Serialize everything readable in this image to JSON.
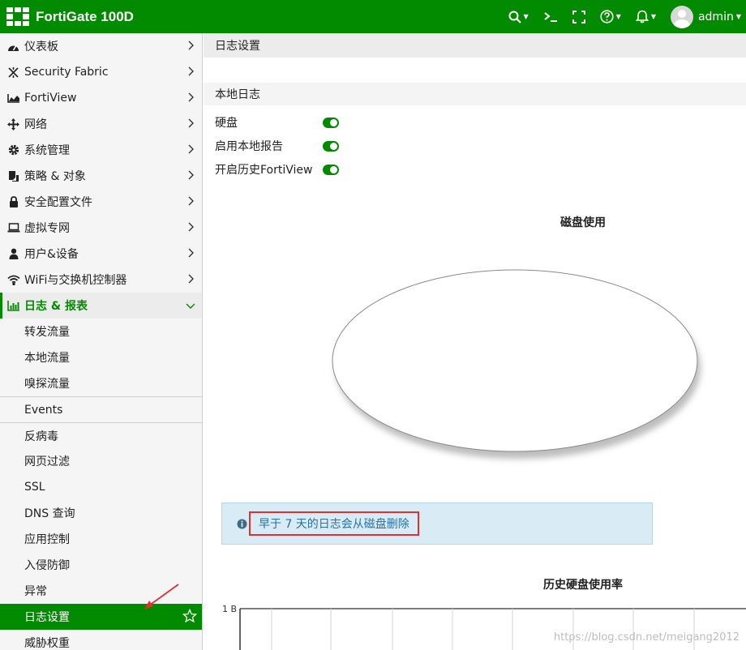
{
  "topbar": {
    "brand": "FortiGate 100D",
    "user": "admin",
    "color": "#028a00"
  },
  "sidebar": {
    "items": [
      {
        "label": "仪表板",
        "icon": "dashboard-icon"
      },
      {
        "label": "Security Fabric",
        "icon": "security-fabric-icon"
      },
      {
        "label": "FortiView",
        "icon": "fortiview-icon"
      },
      {
        "label": "网络",
        "icon": "network-icon"
      },
      {
        "label": "系统管理",
        "icon": "gear-icon"
      },
      {
        "label": "策略 & 对象",
        "icon": "policy-icon"
      },
      {
        "label": "安全配置文件",
        "icon": "lock-icon"
      },
      {
        "label": "虚拟专网",
        "icon": "laptop-icon"
      },
      {
        "label": "用户&设备",
        "icon": "user-icon"
      },
      {
        "label": "WiFi与交换机控制器",
        "icon": "wifi-icon"
      },
      {
        "label": "日志 & 报表",
        "icon": "log-report-icon"
      }
    ],
    "subitems": [
      "转发流量",
      "本地流量",
      "嗅探流量",
      "Events",
      "反病毒",
      "网页过滤",
      "SSL",
      "DNS 查询",
      "应用控制",
      "入侵防御",
      "异常",
      "日志设置",
      "威胁权重"
    ]
  },
  "main": {
    "page_title": "日志设置",
    "section_title": "本地日志",
    "toggles": [
      {
        "label": "硬盘",
        "on": true
      },
      {
        "label": "启用本地报告",
        "on": true
      },
      {
        "label": "开启历史FortiView",
        "on": true
      }
    ],
    "disk_chart_title": "磁盘使用",
    "info_text": "早于 7 天的日志会从磁盘删除",
    "history_chart_title": "历史硬盘使用率"
  },
  "chart_data": [
    {
      "type": "pie",
      "title": "磁盘使用",
      "categories": [],
      "values": []
    },
    {
      "type": "line",
      "title": "历史硬盘使用率",
      "ylabel": "",
      "yticks": [
        "1 B"
      ],
      "series": []
    }
  ],
  "watermark": "https://blog.csdn.net/meigang2012"
}
